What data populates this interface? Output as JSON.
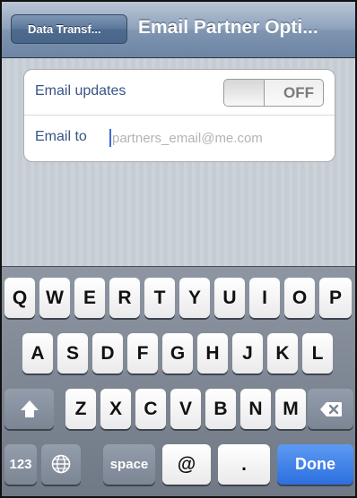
{
  "navbar": {
    "back_label": "Data Transf...",
    "title": "Email Partner Opti..."
  },
  "settings": {
    "email_updates_label": "Email updates",
    "toggle_state": "OFF",
    "email_to_label": "Email to",
    "email_placeholder": "partners_email@me.com",
    "email_value": ""
  },
  "keyboard": {
    "row1": [
      "Q",
      "W",
      "E",
      "R",
      "T",
      "Y",
      "U",
      "I",
      "O",
      "P"
    ],
    "row2": [
      "A",
      "S",
      "D",
      "F",
      "G",
      "H",
      "J",
      "K",
      "L"
    ],
    "row3": [
      "Z",
      "X",
      "C",
      "V",
      "B",
      "N",
      "M"
    ],
    "numbers_key": "123",
    "globe_key_icon": "globe-icon",
    "space_key": "space",
    "at_key": "@",
    "dot_key": ".",
    "done_key": "Done",
    "shift_key_icon": "shift-arrow-icon",
    "delete_key_icon": "delete-backspace-icon"
  },
  "colors": {
    "navbar": "#8ea2bc",
    "label_text": "#385487",
    "done_key": "#2c6fdf"
  }
}
